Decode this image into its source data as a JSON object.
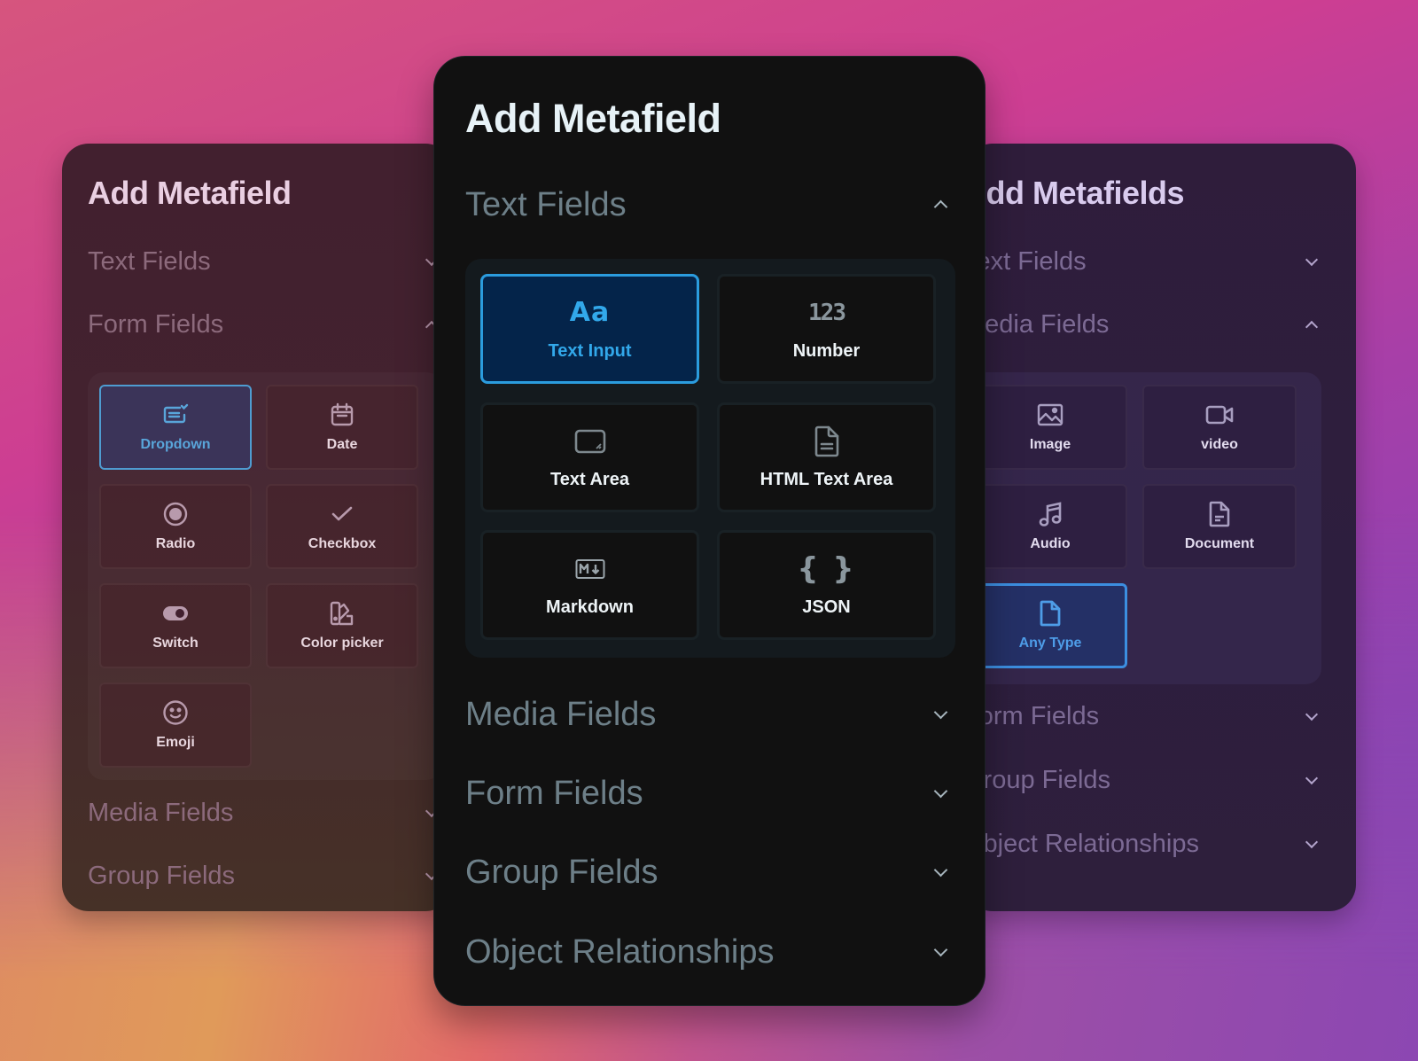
{
  "colors": {
    "accent_blue": "#2b9cde",
    "center_bg": "#111111",
    "center_title": "#e7f2f7",
    "section_label": "#6d7f88"
  },
  "left_panel": {
    "title": "Add Metafield",
    "sections": [
      {
        "label": "Text Fields",
        "expanded": false
      },
      {
        "label": "Form Fields",
        "expanded": true
      },
      {
        "label": "Media Fields",
        "expanded": false
      },
      {
        "label": "Group Fields",
        "expanded": false
      }
    ],
    "tiles": [
      {
        "label": "Dropdown",
        "icon": "dropdown-icon",
        "selected": true
      },
      {
        "label": "Date",
        "icon": "calendar-icon",
        "selected": false
      },
      {
        "label": "Radio",
        "icon": "radio-icon",
        "selected": false
      },
      {
        "label": "Checkbox",
        "icon": "check-icon",
        "selected": false
      },
      {
        "label": "Switch",
        "icon": "toggle-icon",
        "selected": false
      },
      {
        "label": "Color picker",
        "icon": "color-swatch-icon",
        "selected": false
      },
      {
        "label": "Emoji",
        "icon": "smiley-icon",
        "selected": false
      }
    ]
  },
  "center_panel": {
    "title": "Add Metafield",
    "sections": [
      {
        "label": "Text Fields",
        "expanded": true
      },
      {
        "label": "Media Fields",
        "expanded": false
      },
      {
        "label": "Form Fields",
        "expanded": false
      },
      {
        "label": "Group Fields",
        "expanded": false
      },
      {
        "label": "Object Relationships",
        "expanded": false
      }
    ],
    "tiles": [
      {
        "label": "Text Input",
        "icon": "text-aa-icon",
        "selected": true
      },
      {
        "label": "Number",
        "icon": "number-123-icon",
        "selected": false
      },
      {
        "label": "Text Area",
        "icon": "textarea-icon",
        "selected": false
      },
      {
        "label": "HTML Text Area",
        "icon": "document-text-icon",
        "selected": false
      },
      {
        "label": "Markdown",
        "icon": "markdown-icon",
        "selected": false
      },
      {
        "label": "JSON",
        "icon": "braces-icon",
        "selected": false
      }
    ],
    "icon_glyphs": {
      "text": "Aa",
      "number": "123",
      "markdown": "M↓",
      "json": "{ }"
    }
  },
  "right_panel": {
    "title": "Add Metafields",
    "sections": [
      {
        "label": "Text Fields",
        "expanded": false
      },
      {
        "label": "Media Fields",
        "expanded": true
      },
      {
        "label": "Form Fields",
        "expanded": false
      },
      {
        "label": "Group Fields",
        "expanded": false
      },
      {
        "label": "Object Relationships",
        "expanded": false
      }
    ],
    "tiles": [
      {
        "label": "Image",
        "icon": "image-icon",
        "selected": false
      },
      {
        "label": "video",
        "icon": "video-icon",
        "selected": false
      },
      {
        "label": "Audio",
        "icon": "music-note-icon",
        "selected": false
      },
      {
        "label": "Document",
        "icon": "document-icon",
        "selected": false
      },
      {
        "label": "Any Type",
        "icon": "file-icon",
        "selected": true
      }
    ]
  }
}
